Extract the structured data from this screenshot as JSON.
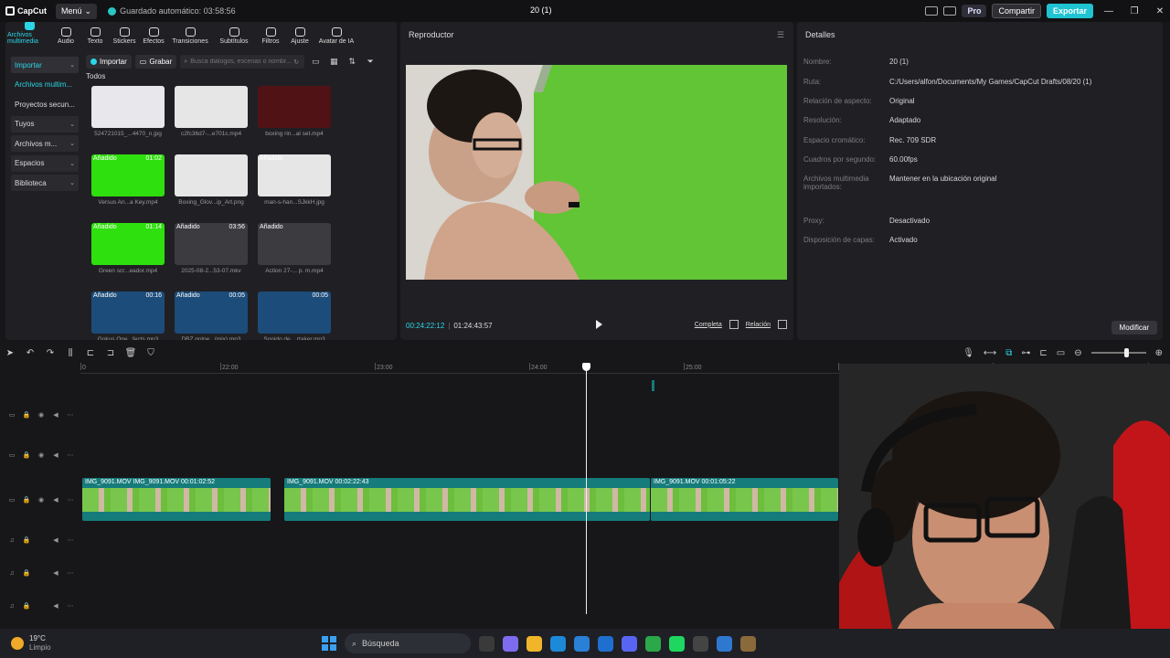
{
  "titlebar": {
    "app_name": "CapCut",
    "menu_label": "Menú",
    "autosave": "Guardado automático: 03:58:56",
    "project_title": "20 (1)",
    "pro_label": "Pro",
    "share_label": "Compartir",
    "export_label": "Exportar"
  },
  "toolbar_tabs": [
    {
      "label": "Archivos multimedia",
      "icon": "media-icon"
    },
    {
      "label": "Audio",
      "icon": "audio-icon"
    },
    {
      "label": "Texto",
      "icon": "text-icon"
    },
    {
      "label": "Stickers",
      "icon": "sticker-icon"
    },
    {
      "label": "Efectos",
      "icon": "effects-icon"
    },
    {
      "label": "Transiciones",
      "icon": "transitions-icon"
    },
    {
      "label": "Subtítulos",
      "icon": "subtitles-icon"
    },
    {
      "label": "Filtros",
      "icon": "filters-icon"
    },
    {
      "label": "Ajuste",
      "icon": "adjust-icon"
    },
    {
      "label": "Avatar de IA",
      "icon": "avatar-icon"
    }
  ],
  "media_sidebar": [
    {
      "label": "Importar"
    },
    {
      "label": "Archivos multim..."
    },
    {
      "label": "Proyectos secun..."
    },
    {
      "label": "Tuyos"
    },
    {
      "label": "Archivos m..."
    },
    {
      "label": "Espacios"
    },
    {
      "label": "Biblioteca"
    }
  ],
  "media_toolbar": {
    "import_label": "Importar",
    "record_label": "Grabar",
    "search_placeholder": "Busca diálogos, escenas o nombr..."
  },
  "media_section_label": "Todos",
  "media_items": [
    {
      "name": "524721015_...4470_n.jpg",
      "badge": "",
      "duration": "",
      "thumb": "g-logo"
    },
    {
      "name": "c2fc36d7-...e701c.mp4",
      "badge": "",
      "duration": "",
      "thumb": "g-white"
    },
    {
      "name": "boxing rin...al set.mp4",
      "badge": "",
      "duration": "",
      "thumb": "g-ring"
    },
    {
      "name": "Versus An...a Key.mp4",
      "badge": "Añadido",
      "duration": "01:02",
      "thumb": "g-green"
    },
    {
      "name": "Boxing_Glov...ip_Art.png",
      "badge": "",
      "duration": "",
      "thumb": "g-white"
    },
    {
      "name": "man-s-han...SJkkH.jpg",
      "badge": "Añadido",
      "duration": "",
      "thumb": "g-white"
    },
    {
      "name": "Green scr...eador.mp4",
      "badge": "Añadido",
      "duration": "01:14",
      "thumb": "g-green"
    },
    {
      "name": "2025-08-2...53-07.mkv",
      "badge": "Añadido",
      "duration": "03:56",
      "thumb": "g-dark"
    },
    {
      "name": "Action 27-... p. m.mp4",
      "badge": "Añadido",
      "duration": "",
      "thumb": "g-dark"
    },
    {
      "name": "Gokus One...fects.mp3",
      "badge": "Añadido",
      "duration": "00:16",
      "thumb": "g-audio"
    },
    {
      "name": "DBZ golpe...(mix).mp3",
      "badge": "Añadido",
      "duration": "00:05",
      "thumb": "g-audio"
    },
    {
      "name": "Sonido de ...rtaker.mp3",
      "badge": "",
      "duration": "00:05",
      "thumb": "g-audio"
    }
  ],
  "player": {
    "title": "Reproductor",
    "current_time": "00:24:22:12",
    "total_time": "01:24:43:57",
    "full_label": "Completa",
    "ratio_label": "Relación"
  },
  "details": {
    "title": "Detalles",
    "rows": [
      {
        "key": "Nombre:",
        "value": "20 (1)"
      },
      {
        "key": "Ruta:",
        "value": "C:/Users/alfon/Documents/My Games/CapCut Drafts/08/20 (1)"
      },
      {
        "key": "Relación de aspecto:",
        "value": "Original"
      },
      {
        "key": "Resolución:",
        "value": "Adaptado"
      },
      {
        "key": "Espacio cromático:",
        "value": "Rec. 709 SDR"
      },
      {
        "key": "Cuadros por segundo:",
        "value": "60.00fps"
      },
      {
        "key": "Archivos multimedia importados:",
        "value": "Mantener en la ubicación original"
      },
      {
        "key": "Proxy:",
        "value": "Desactivado"
      },
      {
        "key": "Disposición de capas:",
        "value": "Activado"
      }
    ],
    "modify_label": "Modificar"
  },
  "ruler_ticks": [
    "0",
    "22:00",
    "23:00",
    "24:00",
    "25:00",
    "26:00",
    "27:00",
    "28:0"
  ],
  "clips": [
    {
      "label": "IMG_9091.MOV   IMG_9091.MOV   00:01:02:52"
    },
    {
      "label": "IMG_9091.MOV   00:02:22:43"
    },
    {
      "label": "IMG_9091.MOV   00:01:05:22"
    }
  ],
  "taskbar": {
    "temperature": "19°C",
    "condition": "Limpio",
    "search_label": "Búsqueda"
  }
}
